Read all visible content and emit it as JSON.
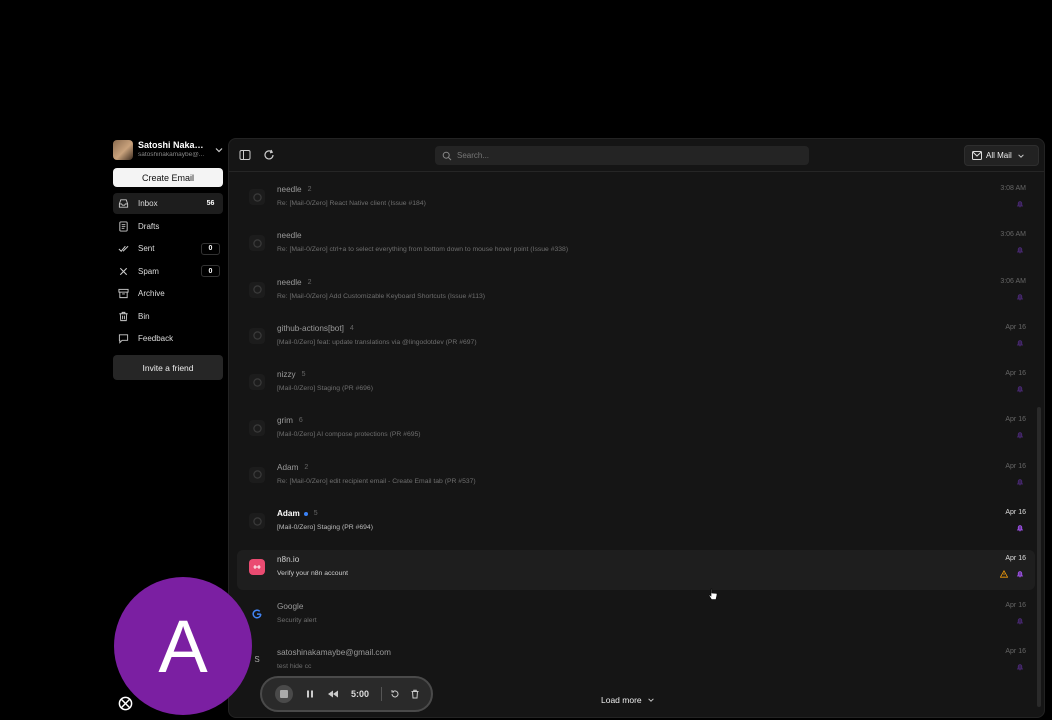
{
  "account": {
    "name": "Satoshi Nakama...",
    "email": "satoshinakamaybe@..."
  },
  "sidebar": {
    "create_label": "Create Email",
    "items": [
      {
        "label": "Inbox",
        "count": "56",
        "icon": "inbox-icon"
      },
      {
        "label": "Drafts",
        "count": "",
        "icon": "drafts-icon"
      },
      {
        "label": "Sent",
        "count": "0",
        "icon": "sent-icon"
      },
      {
        "label": "Spam",
        "count": "0",
        "icon": "spam-icon"
      },
      {
        "label": "Archive",
        "count": "",
        "icon": "archive-icon"
      },
      {
        "label": "Bin",
        "count": "",
        "icon": "bin-icon"
      },
      {
        "label": "Feedback",
        "count": "",
        "icon": "feedback-icon"
      }
    ],
    "invite_label": "Invite a friend"
  },
  "toolbar": {
    "search_placeholder": "Search...",
    "filter_label": "All Mail"
  },
  "emails": [
    {
      "sender": "needle",
      "count": "2",
      "subject": "Re: [Mail-0/Zero] React Native client (Issue #184)",
      "date": "3:08 AM",
      "unread": false
    },
    {
      "sender": "needle",
      "count": "",
      "subject": "Re: [Mail-0/Zero] ctrl+a to select everything from bottom down to mouse hover point (Issue #338)",
      "date": "3:06 AM",
      "unread": false
    },
    {
      "sender": "needle",
      "count": "2",
      "subject": "Re: [Mail-0/Zero] Add Customizable Keyboard Shortcuts (Issue #113)",
      "date": "3:06 AM",
      "unread": false
    },
    {
      "sender": "github-actions[bot]",
      "count": "4",
      "subject": "[Mail-0/Zero] feat: update translations via @lingodotdev (PR #697)",
      "date": "Apr 16",
      "unread": false
    },
    {
      "sender": "nizzy",
      "count": "5",
      "subject": "[Mail-0/Zero] Staging (PR #696)",
      "date": "Apr 16",
      "unread": false
    },
    {
      "sender": "grim",
      "count": "6",
      "subject": "[Mail-0/Zero] AI compose protections (PR #695)",
      "date": "Apr 16",
      "unread": false
    },
    {
      "sender": "Adam",
      "count": "2",
      "subject": "Re: [Mail-0/Zero] edit recipient email - Create Email tab (PR #537)",
      "date": "Apr 16",
      "unread": false
    },
    {
      "sender": "Adam",
      "count": "5",
      "subject": "[Mail-0/Zero] Staging (PR #694)",
      "date": "Apr 16",
      "unread": true
    },
    {
      "sender": "n8n.io",
      "count": "",
      "subject": "Verify your n8n account",
      "date": "Apr 16",
      "unread": false,
      "hovered": true
    },
    {
      "sender": "Google",
      "count": "",
      "subject": "Security alert",
      "date": "Apr 16",
      "unread": false
    },
    {
      "sender": "satoshinakamaybe@gmail.com",
      "count": "",
      "subject": "test hide cc",
      "date": "Apr 16",
      "unread": false,
      "avatar_letter": "S"
    }
  ],
  "load_more_label": "Load more",
  "recorder": {
    "time": "5:00"
  },
  "overlay_avatar_letter": "A",
  "colors": {
    "accent": "#7b1fa2",
    "bell": "#7c3aed",
    "warning": "#f59e0b",
    "unread_dot": "#3b82f6",
    "n8n": "#ea4b71"
  }
}
